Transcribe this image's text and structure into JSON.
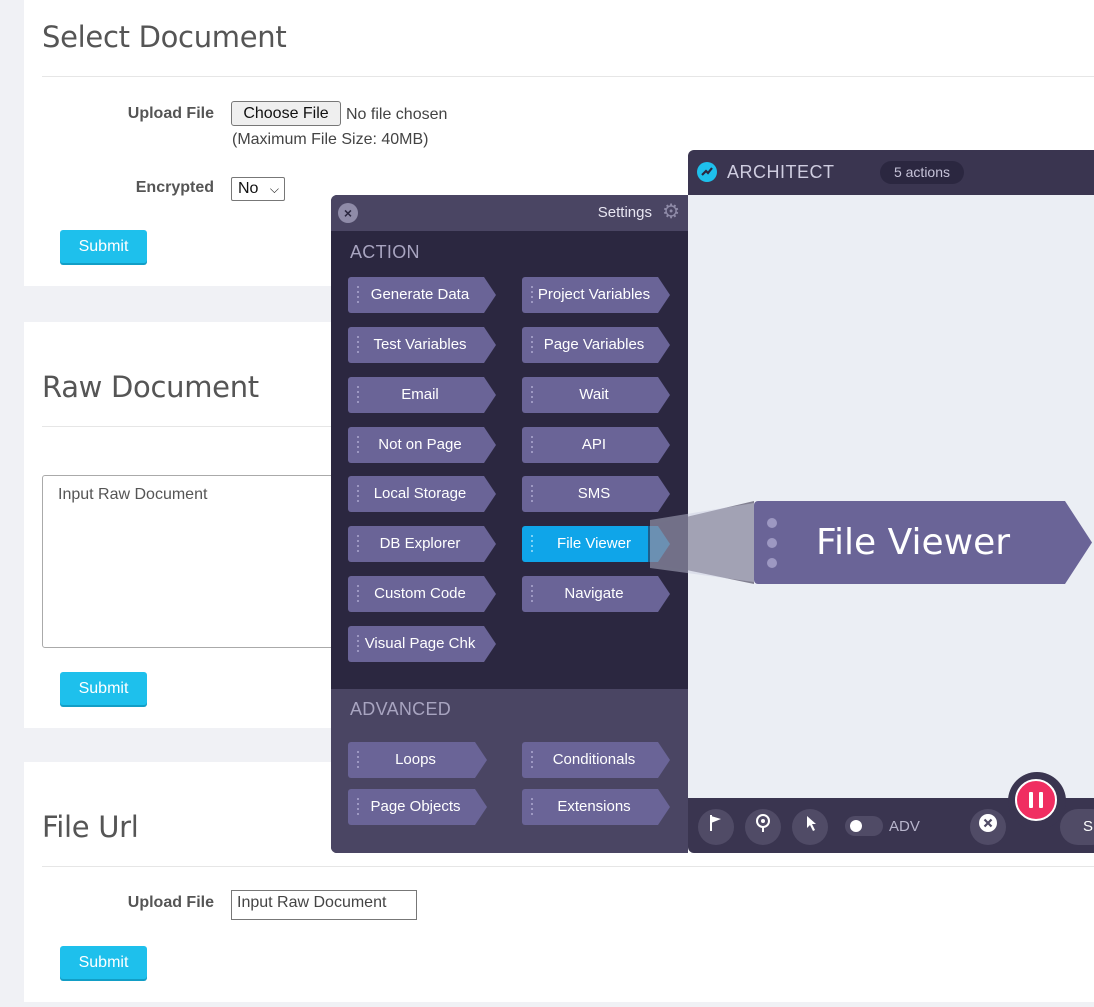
{
  "select_document": {
    "title": "Select Document",
    "upload_label": "Upload File",
    "choose_file_label": "Choose File",
    "no_file_text": "No file chosen",
    "max_size_text": "(Maximum File Size: 40MB)",
    "encrypted_label": "Encrypted",
    "encrypted_value": "No",
    "submit_label": "Submit"
  },
  "raw_document": {
    "title": "Raw Document",
    "textarea_placeholder": "Input Raw Document",
    "submit_label": "Submit"
  },
  "file_url": {
    "title": "File Url",
    "upload_label": "Upload File",
    "input_value": "Input Raw Document",
    "submit_label": "Submit"
  },
  "architect": {
    "title": "ARCHITECT",
    "actions_badge": "5 actions",
    "adv_toggle_label": "ADV",
    "partial_button_label": "S"
  },
  "settings": {
    "title": "Settings",
    "action_section": "ACTION",
    "advanced_section": "ADVANCED",
    "actions": [
      "Generate Data",
      "Project Variables",
      "Test Variables",
      "Page Variables",
      "Email",
      "Wait",
      "Not on Page",
      "API",
      "Local Storage",
      "SMS",
      "DB Explorer",
      "File Viewer",
      "Custom Code",
      "Navigate",
      "Visual Page Chk"
    ],
    "active_action": "File Viewer",
    "advanced": [
      "Loops",
      "Conditionals",
      "Page Objects",
      "Extensions"
    ]
  },
  "callout": {
    "label": "File Viewer"
  },
  "colors": {
    "accent": "#1ec0ec",
    "active_action": "#0fa5e9",
    "panel_dark": "#2b2740",
    "pause": "#f02e61"
  },
  "icons": [
    "close-icon",
    "gear-icon",
    "flag-icon",
    "eye-icon",
    "pointer-icon",
    "close-circle-icon",
    "pause-icon",
    "architect-logo-icon"
  ]
}
